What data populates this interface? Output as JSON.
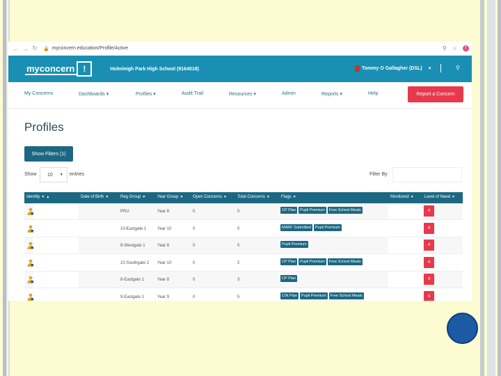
{
  "browser": {
    "url": "myconcern.education/Profile/Active",
    "back_icon": "back-arrow-icon",
    "forward_icon": "forward-arrow-icon",
    "reload_icon": "reload-icon",
    "profile_initial": "T"
  },
  "header": {
    "logo_text": "myconcern",
    "logo_mark": "!",
    "school": "Holmleigh Park High School (9164018)",
    "user": "Tommy O Gallagher",
    "user_suffix": "(DSL)"
  },
  "menu": {
    "items": [
      "My Concerns",
      "Dashboards ▾",
      "Profiles ▾",
      "Audit Trail",
      "Resources ▾",
      "Admin",
      "Reports ▾",
      "Help"
    ],
    "report_button": "Report a Concern"
  },
  "page": {
    "title": "Profiles",
    "show_filters": "Show Filters (1)",
    "show_label": "Show",
    "entries_value": "10",
    "entries_label": "entries",
    "filter_by": "Filter By"
  },
  "table": {
    "headers": [
      "Identity",
      "Date of Birth",
      "Reg Group",
      "Year Group",
      "Open Concerns",
      "Total Concerns",
      "Flags",
      "Monitored",
      "Level of Need"
    ],
    "rows": [
      {
        "reg": "PRU",
        "year": "Year 8",
        "open": "0",
        "total": "0",
        "flags": [
          "CP Plan",
          "Pupil Premium",
          "Free School Meals"
        ],
        "need": "4"
      },
      {
        "reg": "10-Eastgate 1",
        "year": "Year 10",
        "open": "0",
        "total": "0",
        "flags": [
          "MARF Submitted",
          "Pupil Premium"
        ],
        "need": "4"
      },
      {
        "reg": "8-Westgate 1",
        "year": "Year 8",
        "open": "0",
        "total": "0",
        "flags": [
          "Pupil Premium"
        ],
        "need": "4"
      },
      {
        "reg": "10-Southgate 2",
        "year": "Year 10",
        "open": "0",
        "total": "2",
        "flags": [
          "CP Plan",
          "Pupil Premium",
          "Free School Meals"
        ],
        "need": "4"
      },
      {
        "reg": "8-Eastgate 1",
        "year": "Year 8",
        "open": "0",
        "total": "3",
        "flags": [
          "CP Plan"
        ],
        "need": "4"
      },
      {
        "reg": "9-Eastgate 1",
        "year": "Year 9",
        "open": "0",
        "total": "5",
        "flags": [
          "CIN Plan",
          "Pupil Premium",
          "Free School Meals"
        ],
        "need": "4"
      }
    ]
  },
  "colors": {
    "brand": "#1a8fb3",
    "table_header": "#1c6883",
    "accent_red": "#e8394c",
    "slide_bg": "#fdfbd2"
  }
}
